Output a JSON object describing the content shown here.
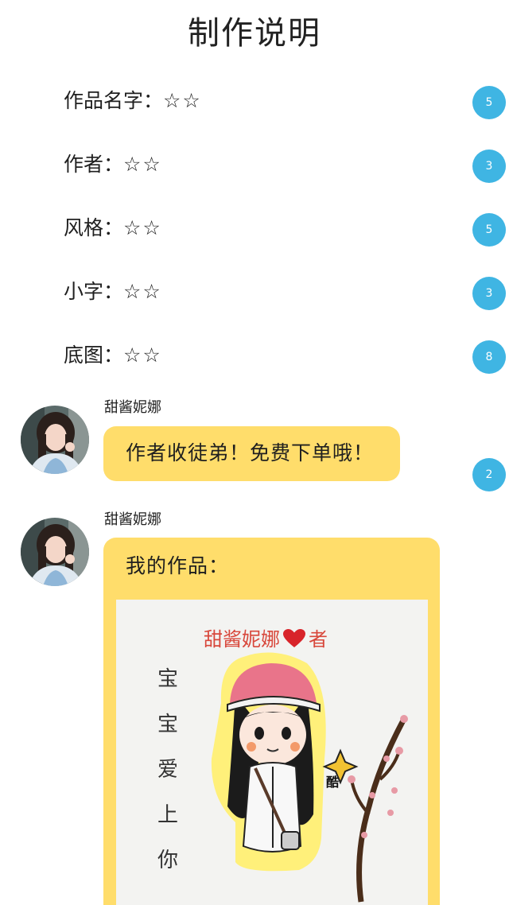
{
  "title": "制作说明",
  "info": [
    {
      "label": "作品名字：",
      "value": "☆☆",
      "badge": "5"
    },
    {
      "label": "作者：",
      "value": "☆☆",
      "badge": "3"
    },
    {
      "label": "风格：",
      "value": "☆☆",
      "badge": "5"
    },
    {
      "label": "小字：",
      "value": "☆☆",
      "badge": "3"
    },
    {
      "label": "底图：",
      "value": "☆☆",
      "badge": "8"
    }
  ],
  "messages": [
    {
      "sender": "甜酱妮娜",
      "text": "作者收徒弟！免费下单哦！",
      "badge": "2"
    },
    {
      "sender": "甜酱妮娜",
      "text": "我的作品：",
      "artwork": {
        "signature": "甜酱妮娜",
        "signature_suffix": "者",
        "vertical_text": "宝宝爱上你",
        "sticker": "酷"
      }
    }
  ],
  "colors": {
    "bubble": "#ffdd6b",
    "badge": "#3fb5e3",
    "heart": "#d8242a"
  }
}
